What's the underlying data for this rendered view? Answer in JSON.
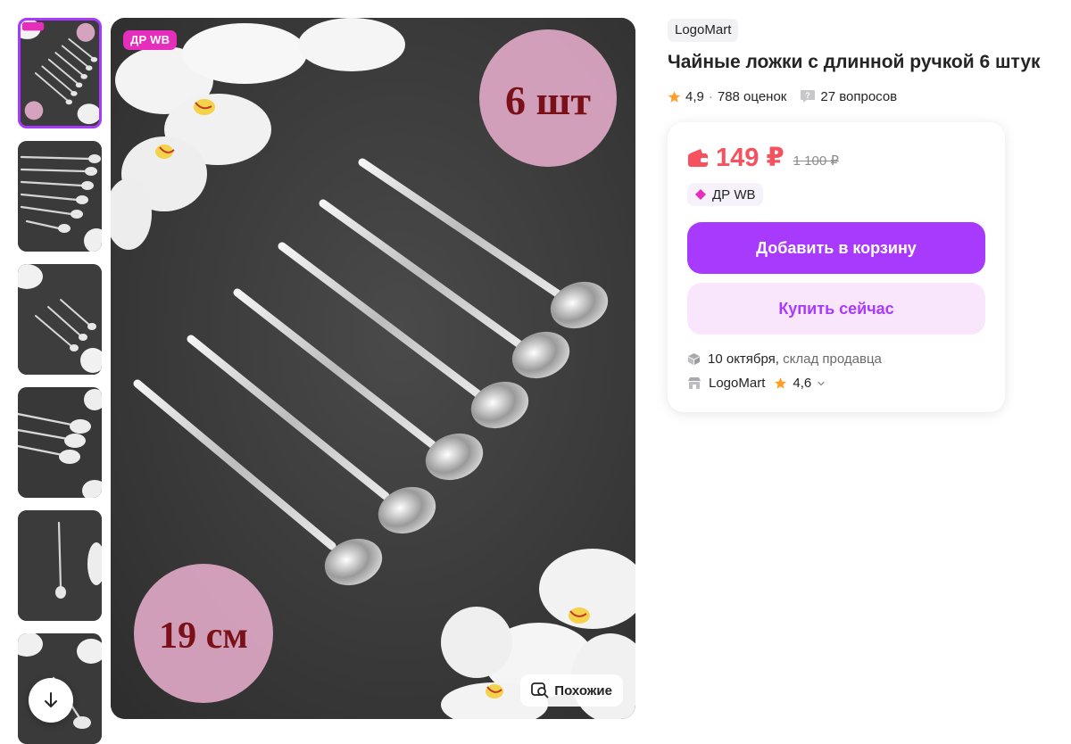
{
  "gallery": {
    "main_badge": "ДР WB",
    "main_qty_label": "6 шт",
    "main_size_label": "19 см",
    "similar_label": "Похожие",
    "thumb_qty_label": "6 шт",
    "thumb_size_label": "19 см",
    "thumbnails": [
      "thumb-1",
      "thumb-2",
      "thumb-3",
      "thumb-4",
      "thumb-5",
      "thumb-6"
    ],
    "active_thumbnail": 0
  },
  "product": {
    "brand": "LogoMart",
    "title": "Чайные ложки с длинной ручкой 6 штук",
    "rating": "4,9",
    "reviews": "788 оценок",
    "questions": "27 вопросов"
  },
  "buy_box": {
    "price": "149 ₽",
    "old_price": "1 100 ₽",
    "promo": "ДР WB",
    "add_to_cart": "Добавить в корзину",
    "buy_now": "Купить сейчас",
    "delivery_date": "10 октября,",
    "delivery_source": "склад продавца",
    "seller_name": "LogoMart",
    "seller_rating": "4,6"
  },
  "colors": {
    "accent": "#a73afd",
    "price": "#f5515f",
    "promo": "#e62ebd",
    "star": "#ff9f29"
  },
  "icons": [
    "wallet-icon",
    "star-icon",
    "question-icon",
    "promo-diamond-icon",
    "box-icon",
    "shop-icon",
    "chevron-down-icon",
    "search-image-icon",
    "arrow-down-icon"
  ]
}
